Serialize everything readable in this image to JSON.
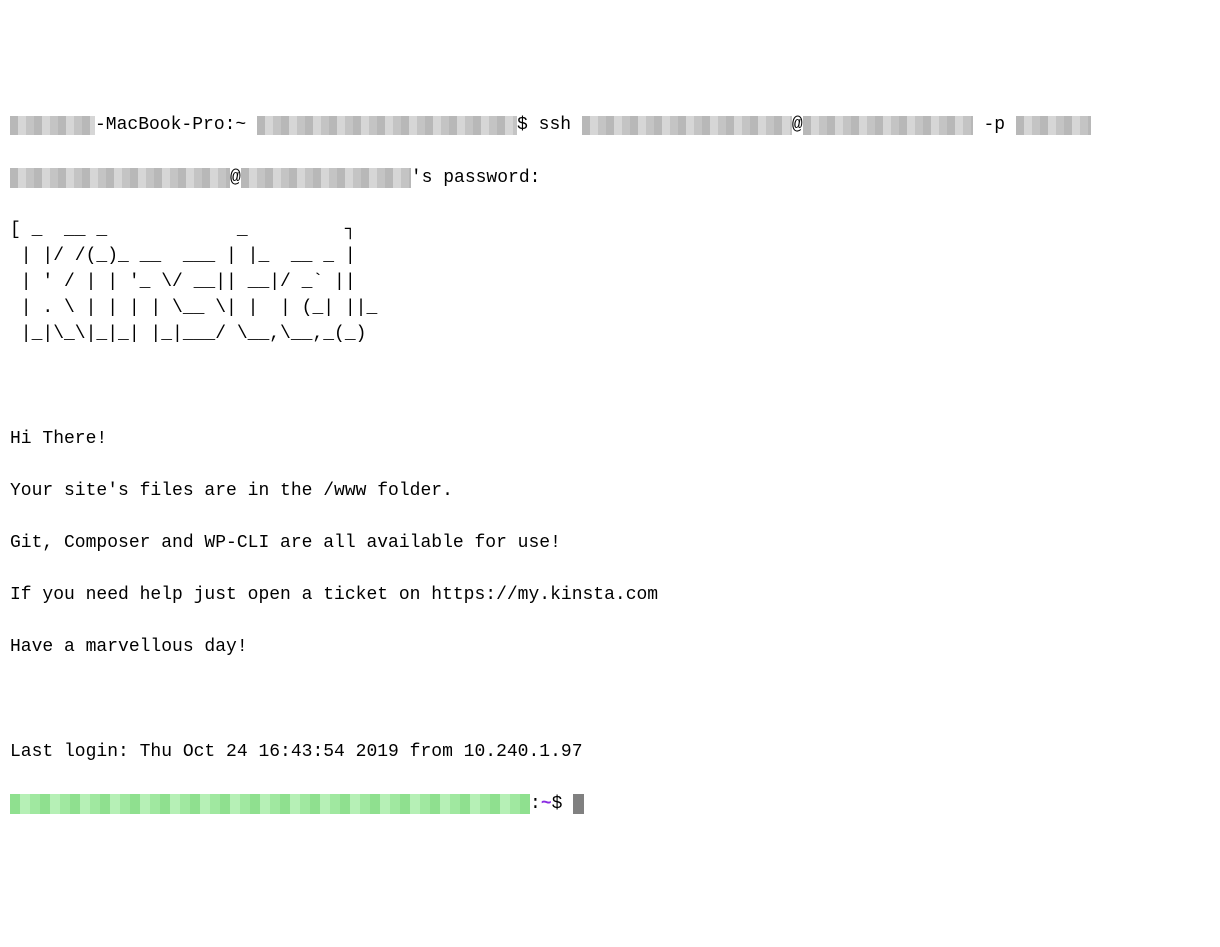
{
  "local_prompt": {
    "prefix_host": "-MacBook-Pro:~ ",
    "dollar": "$ ",
    "cmd_prefix": "ssh ",
    "at": "@",
    "flag": " -p "
  },
  "password_prompt": {
    "at": "@",
    "suffix": "'s password:"
  },
  "ascii_art": "[ _  __ _            _         ┐\n | |/ /(_)_ __  ___ | |_  __ _ |\n | ' / | | '_ \\/ __|| __|/ _` ||\n | . \\ | | | | \\__ \\| |  | (_| ||_\n |_|\\_\\|_|_| |_|___/ \\__,\\__,_(_)",
  "motd": {
    "l1": "Hi There!",
    "l2": "Your site's files are in the /www folder.",
    "l3": "Git, Composer and WP-CLI are all available for use!",
    "l4": "If you need help just open a ticket on https://my.kinsta.com",
    "l5": "Have a marvellous day!"
  },
  "last_login": "Last login: Thu Oct 24 16:43:54 2019 from 10.240.1.97",
  "remote_prompt": {
    "colon": ":",
    "tilde": "~",
    "dollar": "$ "
  }
}
